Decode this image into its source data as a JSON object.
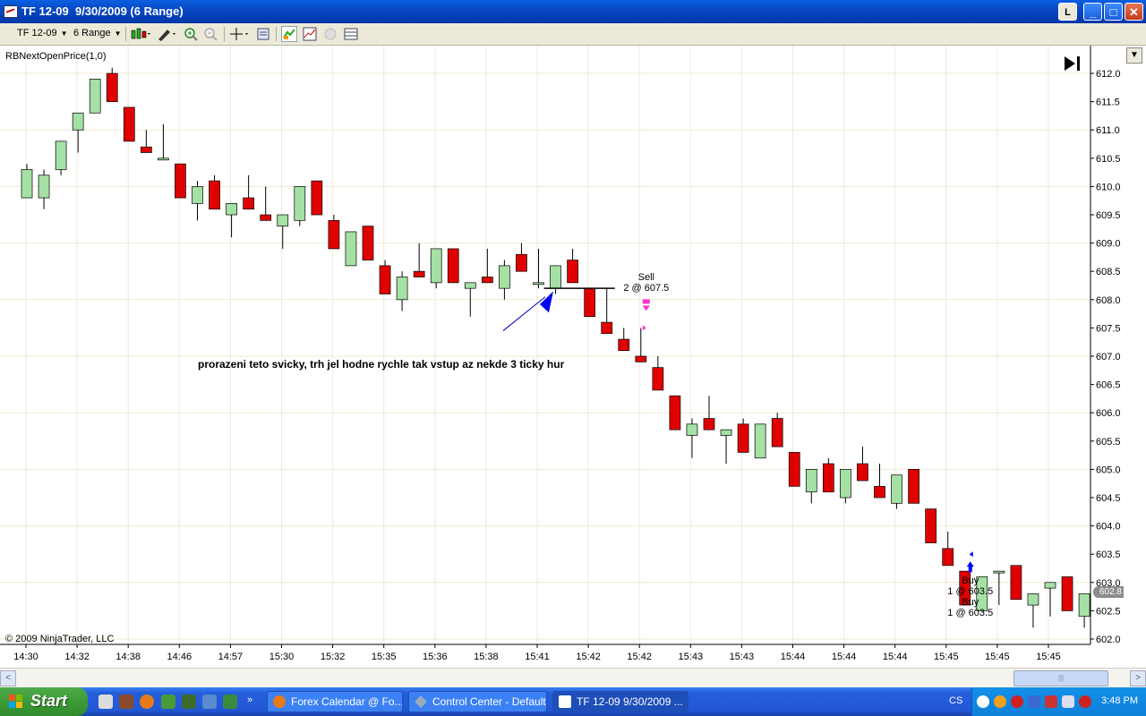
{
  "window": {
    "title": "TF 12-09  9/30/2009 (6 Range)",
    "buttons": {
      "layout": "L",
      "minimize": "_",
      "maximize": "□",
      "close": "✕"
    }
  },
  "toolbar": {
    "instrument": "TF 12-09",
    "period": "6 Range",
    "icons": [
      "candlestick-style-icon",
      "drawing-pencil-icon",
      "zoom-in-icon",
      "zoom-out-icon",
      "crosshair-icon",
      "properties-icon",
      "strategy-icon",
      "indicator-icon",
      "data-box-icon",
      "chart-trader-icon"
    ]
  },
  "chart": {
    "indicator_label": "RBNextOpenPrice(1,0)",
    "copyright": "© 2009 NinjaTrader, LLC",
    "annotation": "prorazeni teto svicky, trh jel hodne rychle tak vstup az nekde 3 ticky hur",
    "current_price": "602.8",
    "colors": {
      "up": "#a5e0a5",
      "down": "#e00000",
      "grid": "#f0ead2",
      "signal_sell": "#ff33cc",
      "signal_buy": "#0000ff"
    }
  },
  "chart_data": {
    "type": "candlestick",
    "ylim": [
      601.95,
      612.1
    ],
    "y_ticks": [
      "612.0",
      "611.5",
      "611.0",
      "610.5",
      "610.0",
      "609.5",
      "609.0",
      "608.5",
      "608.0",
      "607.5",
      "607.0",
      "606.5",
      "606.0",
      "605.5",
      "605.0",
      "604.5",
      "604.0",
      "603.5",
      "603.0",
      "602.5",
      "602.0"
    ],
    "x_ticks": [
      "14:30",
      "14:32",
      "14:38",
      "14:46",
      "14:57",
      "15:30",
      "15:32",
      "15:35",
      "15:36",
      "15:38",
      "15:41",
      "15:42",
      "15:42",
      "15:43",
      "15:43",
      "15:44",
      "15:44",
      "15:44",
      "15:45",
      "15:45",
      "15:45"
    ],
    "candles": [
      {
        "o": 609.8,
        "h": 610.4,
        "l": 609.8,
        "c": 610.3
      },
      {
        "o": 609.8,
        "h": 610.3,
        "l": 609.6,
        "c": 610.2
      },
      {
        "o": 610.3,
        "h": 610.8,
        "l": 610.2,
        "c": 610.8
      },
      {
        "o": 611.0,
        "h": 611.3,
        "l": 610.6,
        "c": 611.3
      },
      {
        "o": 611.3,
        "h": 611.9,
        "l": 611.3,
        "c": 611.9
      },
      {
        "o": 612.0,
        "h": 612.1,
        "l": 611.5,
        "c": 611.5
      },
      {
        "o": 611.4,
        "h": 611.4,
        "l": 610.8,
        "c": 610.8
      },
      {
        "o": 610.7,
        "h": 611.0,
        "l": 610.6,
        "c": 610.6
      },
      {
        "o": 610.5,
        "h": 611.1,
        "l": 610.5,
        "c": 610.5
      },
      {
        "o": 610.4,
        "h": 610.4,
        "l": 609.8,
        "c": 609.8
      },
      {
        "o": 609.7,
        "h": 610.1,
        "l": 609.4,
        "c": 610.0
      },
      {
        "o": 610.1,
        "h": 610.2,
        "l": 609.6,
        "c": 609.6
      },
      {
        "o": 609.5,
        "h": 609.7,
        "l": 609.1,
        "c": 609.7
      },
      {
        "o": 609.8,
        "h": 610.2,
        "l": 609.6,
        "c": 609.6
      },
      {
        "o": 609.5,
        "h": 610.0,
        "l": 609.4,
        "c": 609.4
      },
      {
        "o": 609.3,
        "h": 609.5,
        "l": 608.9,
        "c": 609.5
      },
      {
        "o": 609.4,
        "h": 610.0,
        "l": 609.3,
        "c": 610.0
      },
      {
        "o": 610.1,
        "h": 610.1,
        "l": 609.5,
        "c": 609.5
      },
      {
        "o": 609.4,
        "h": 609.5,
        "l": 608.9,
        "c": 608.9
      },
      {
        "o": 608.6,
        "h": 609.2,
        "l": 608.6,
        "c": 609.2
      },
      {
        "o": 609.3,
        "h": 609.3,
        "l": 608.7,
        "c": 608.7
      },
      {
        "o": 608.6,
        "h": 608.7,
        "l": 608.1,
        "c": 608.1
      },
      {
        "o": 608.0,
        "h": 608.5,
        "l": 607.8,
        "c": 608.4
      },
      {
        "o": 608.5,
        "h": 609.0,
        "l": 608.4,
        "c": 608.4
      },
      {
        "o": 608.3,
        "h": 608.9,
        "l": 608.2,
        "c": 608.9
      },
      {
        "o": 608.9,
        "h": 608.9,
        "l": 608.3,
        "c": 608.3
      },
      {
        "o": 608.2,
        "h": 608.3,
        "l": 607.7,
        "c": 608.3
      },
      {
        "o": 608.4,
        "h": 608.9,
        "l": 608.3,
        "c": 608.3
      },
      {
        "o": 608.2,
        "h": 608.7,
        "l": 608.0,
        "c": 608.6
      },
      {
        "o": 608.8,
        "h": 609.0,
        "l": 608.5,
        "c": 608.5
      },
      {
        "o": 608.3,
        "h": 608.9,
        "l": 608.2,
        "c": 608.3
      },
      {
        "o": 608.2,
        "h": 608.6,
        "l": 608.1,
        "c": 608.6
      },
      {
        "o": 608.7,
        "h": 608.9,
        "l": 608.3,
        "c": 608.3
      },
      {
        "o": 608.2,
        "h": 608.2,
        "l": 607.7,
        "c": 607.7
      },
      {
        "o": 607.6,
        "h": 608.2,
        "l": 607.4,
        "c": 607.4
      },
      {
        "o": 607.3,
        "h": 607.5,
        "l": 607.1,
        "c": 607.1
      },
      {
        "o": 607.0,
        "h": 607.5,
        "l": 606.9,
        "c": 606.9
      },
      {
        "o": 606.8,
        "h": 607.0,
        "l": 606.4,
        "c": 606.4
      },
      {
        "o": 606.3,
        "h": 606.3,
        "l": 605.7,
        "c": 605.7
      },
      {
        "o": 605.6,
        "h": 605.9,
        "l": 605.2,
        "c": 605.8
      },
      {
        "o": 605.9,
        "h": 606.3,
        "l": 605.7,
        "c": 605.7
      },
      {
        "o": 605.6,
        "h": 605.7,
        "l": 605.1,
        "c": 605.7
      },
      {
        "o": 605.8,
        "h": 605.9,
        "l": 605.3,
        "c": 605.3
      },
      {
        "o": 605.2,
        "h": 605.8,
        "l": 605.2,
        "c": 605.8
      },
      {
        "o": 605.9,
        "h": 606.0,
        "l": 605.4,
        "c": 605.4
      },
      {
        "o": 605.3,
        "h": 605.3,
        "l": 604.7,
        "c": 604.7
      },
      {
        "o": 604.6,
        "h": 605.0,
        "l": 604.4,
        "c": 605.0
      },
      {
        "o": 605.1,
        "h": 605.2,
        "l": 604.6,
        "c": 604.6
      },
      {
        "o": 604.5,
        "h": 605.0,
        "l": 604.4,
        "c": 605.0
      },
      {
        "o": 605.1,
        "h": 605.4,
        "l": 604.8,
        "c": 604.8
      },
      {
        "o": 604.7,
        "h": 605.1,
        "l": 604.5,
        "c": 604.5
      },
      {
        "o": 604.4,
        "h": 604.9,
        "l": 604.3,
        "c": 604.9
      },
      {
        "o": 605.0,
        "h": 605.0,
        "l": 604.4,
        "c": 604.4
      },
      {
        "o": 604.3,
        "h": 604.3,
        "l": 603.7,
        "c": 603.7
      },
      {
        "o": 603.6,
        "h": 603.9,
        "l": 603.3,
        "c": 603.3
      },
      {
        "o": 603.2,
        "h": 603.2,
        "l": 602.6,
        "c": 602.6
      },
      {
        "o": 602.5,
        "h": 603.1,
        "l": 602.5,
        "c": 603.1
      },
      {
        "o": 603.2,
        "h": 603.2,
        "l": 602.6,
        "c": 603.2
      },
      {
        "o": 603.3,
        "h": 603.3,
        "l": 602.7,
        "c": 602.7
      },
      {
        "o": 602.6,
        "h": 602.8,
        "l": 602.2,
        "c": 602.8
      },
      {
        "o": 602.9,
        "h": 603.0,
        "l": 602.4,
        "c": 603.0
      },
      {
        "o": 603.1,
        "h": 603.1,
        "l": 602.5,
        "c": 602.5
      },
      {
        "o": 602.4,
        "h": 602.8,
        "l": 602.2,
        "c": 602.8
      }
    ],
    "signals": [
      {
        "type": "sell",
        "label": "Sell",
        "qty": "2 @ 607.5",
        "bar": 36
      },
      {
        "type": "buy",
        "label": "Buy",
        "qty": "1 @ 603.5",
        "bar": 55
      },
      {
        "type": "buy",
        "label": "Buy",
        "qty": "1 @ 603.5",
        "bar": 55
      }
    ]
  },
  "scrollbar": {
    "left": "<",
    "right": ">",
    "thumb": "|||"
  },
  "taskbar": {
    "start": "Start",
    "tasks": [
      {
        "label": "Forex Calendar @ Fo..."
      },
      {
        "label": "Control Center - Default"
      },
      {
        "label": "TF 12-09  9/30/2009 ..."
      }
    ],
    "lang": "CS",
    "clock": "3:48 PM"
  }
}
